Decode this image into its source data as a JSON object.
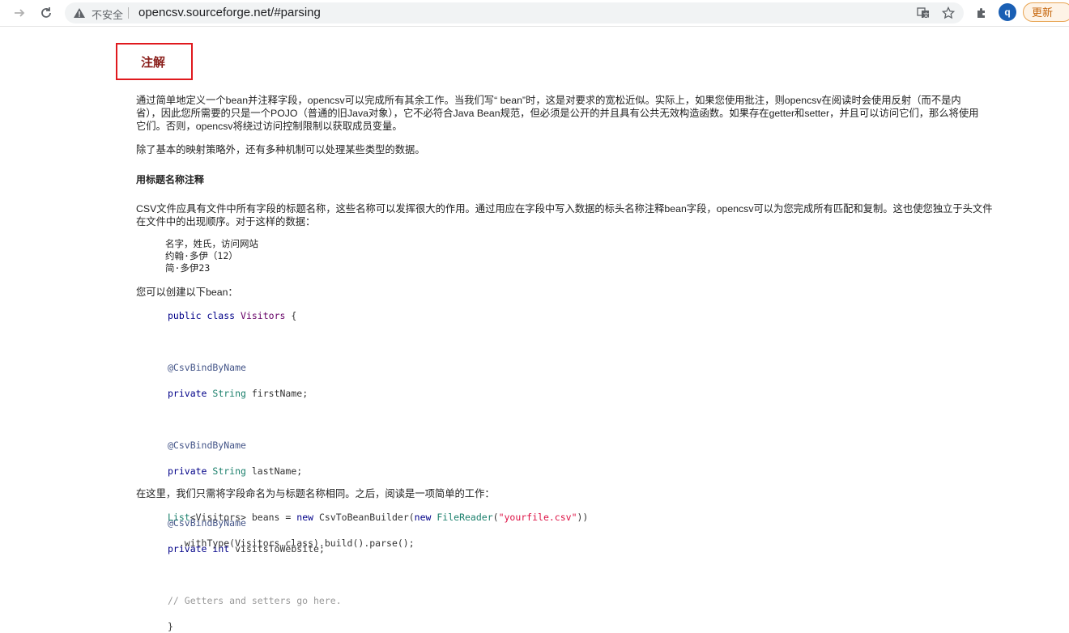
{
  "browser": {
    "insecure_label": "不安全",
    "url": "opencsv.sourceforge.net/#parsing",
    "avatar_letter": "q",
    "update_label": "更新",
    "accent": "#1a5fb4"
  },
  "content": {
    "heading": "注解",
    "intro_p1_line1": "通过简单地定义一个bean并注释字段，opencsv可以完成所有其余工作。当我们写“ bean”时，这是对要求的宽松近似。实际上，如果您使用批注，则opencsv在阅读时会使用反射（而不是内",
    "intro_p1_line2": "省），因此您所需要的只是一个POJO（普通的旧Java对象），它不必符合Java Bean规范，但必须是公开的并且具有公共无效构造函数。如果存在getter和setter，并且可以访问它们，那么将使用",
    "intro_p1_line3": "它们。否则，opencsv将绕过访问控制限制以获取成员变量。",
    "intro_p2": "除了基本的映射策略外，还有多种机制可以处理某些类型的数据。",
    "section_title": "用标题名称注释",
    "section_p1_line1": "CSV文件应具有文件中所有字段的标题名称，这些名称可以发挥很大的作用。通过用应在字段中写入数据的标头名称注释bean字段，opencsv可以为您完成所有匹配和复制。这也使您独立于头文件",
    "section_p1_line2": "在文件中的出现顺序。对于这样的数据：",
    "data_lines": [
      "名字，姓氏，访问网站",
      "约翰·多伊（12）",
      "简·多伊23"
    ],
    "bean_intro": "您可以创建以下bean：",
    "code": {
      "class_kw": "public class",
      "class_name": "Visitors",
      "brace_open": " {",
      "annotation": "@CsvBindByName",
      "private_kw": "private",
      "string_type": "String",
      "int_type": "int",
      "field1": " firstName;",
      "field2": " lastName;",
      "field3": " visitsToWebsite;",
      "comment": "// Getters and setters go here.",
      "brace_close": "}"
    },
    "after_text": "在这里，我们只需将字段命名为与标题名称相同。之后，阅读是一项简单的工作：",
    "code2": {
      "list_type": "List",
      "generic": "<Visitors> beans = ",
      "new_kw": "new",
      "builder": " CsvToBeanBuilder(",
      "new_kw2": "new",
      "reader": " FileReader",
      "paren": "(",
      "string": "\"yourfile.csv\"",
      "close": "))",
      "line2": "  .withType(Visitors.class).build().parse();"
    }
  }
}
